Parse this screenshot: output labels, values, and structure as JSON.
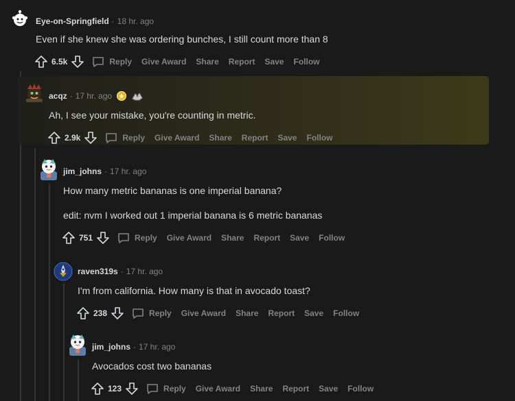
{
  "comments": [
    {
      "author": "Eye-on-Springfield",
      "time": "18 hr. ago",
      "body": [
        "Even if she knew she was ordering bunches, I still count more than 8"
      ],
      "score": "6.5k"
    },
    {
      "author": "acqz",
      "time": "17 hr. ago",
      "body": [
        "Ah, I see your mistake, you're counting in metric."
      ],
      "score": "2.9k"
    },
    {
      "author": "jim_johns",
      "time": "17 hr. ago",
      "body": [
        "How many metric bananas is one imperial banana?",
        "edit: nvm I worked out 1 imperial banana is 6 metric bananas"
      ],
      "score": "751"
    },
    {
      "author": "raven319s",
      "time": "17 hr. ago",
      "body": [
        "I'm from california. How many is that in avocado toast?"
      ],
      "score": "238"
    },
    {
      "author": "jim_johns",
      "time": "17 hr. ago",
      "body": [
        "Avocados cost two bananas"
      ],
      "score": "123"
    }
  ],
  "actions": {
    "reply": "Reply",
    "give_award": "Give Award",
    "share": "Share",
    "report": "Report",
    "save": "Save",
    "follow": "Follow"
  },
  "separator": "·",
  "icons": {
    "upvote": "upvote-icon",
    "downvote": "downvote-icon",
    "reply": "reply-icon",
    "award_gold": "gold-award-icon",
    "award_hands": "helpful-award-icon"
  },
  "colors": {
    "background": "#1a1a1b",
    "text": "#d7dadc",
    "meta": "#818384",
    "thread_line": "#343536",
    "highlight": "#3d3a1a"
  }
}
